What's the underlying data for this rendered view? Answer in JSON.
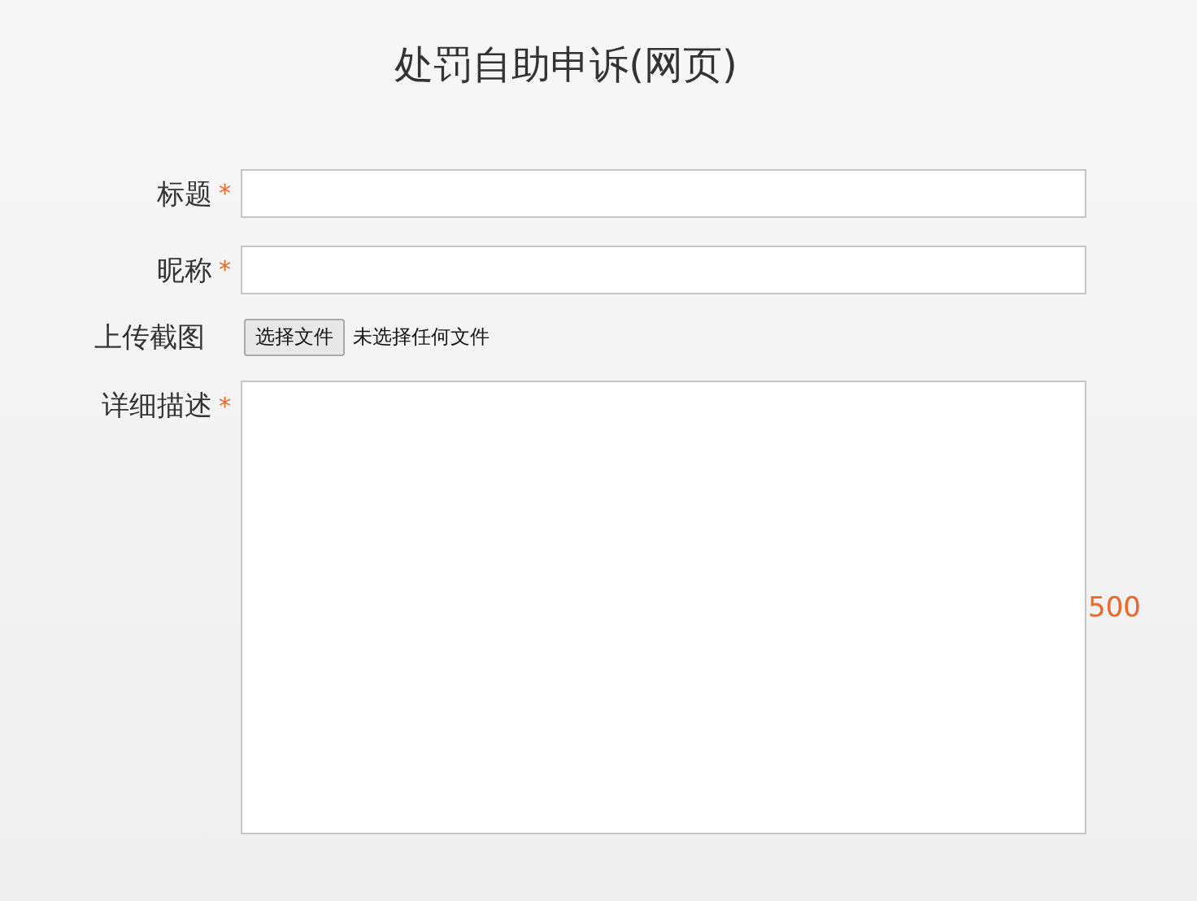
{
  "title": "处罚自助申诉(网页)",
  "fields": [
    {
      "kind": "text",
      "label": "标题",
      "required": true
    },
    {
      "kind": "text",
      "label": "昵称",
      "required": true
    },
    {
      "kind": "file",
      "label": "上传截图",
      "required": false,
      "button": "选择文件",
      "status": "未选择任何文件"
    },
    {
      "kind": "textarea",
      "label": "详细描述",
      "required": true,
      "counter": "500"
    }
  ],
  "required_mark": "*"
}
